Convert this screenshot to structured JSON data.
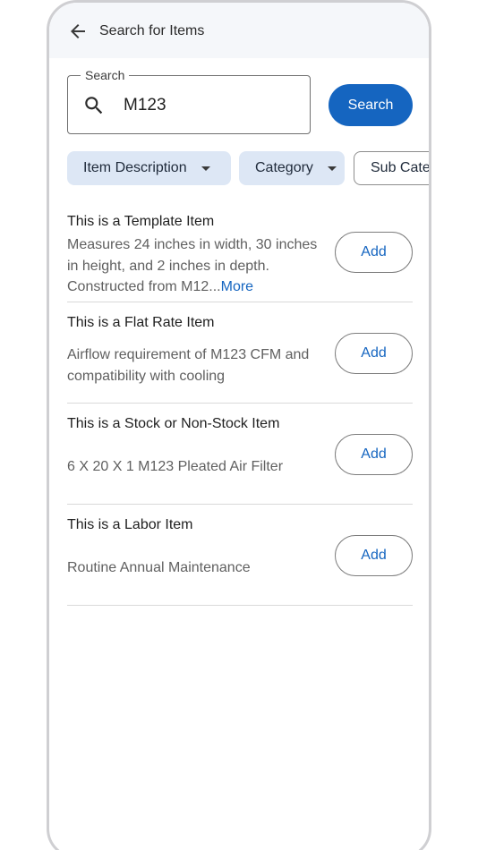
{
  "header": {
    "title": "Search for Items",
    "back_icon": "arrow-left-icon"
  },
  "search": {
    "legend": "Search",
    "value": "M123",
    "icon": "search-icon",
    "button_label": "Search"
  },
  "filters": [
    {
      "label": "Item Description",
      "style": "filled"
    },
    {
      "label": "Category",
      "style": "filled"
    },
    {
      "label": "Sub Cate",
      "style": "outlined"
    }
  ],
  "items": [
    {
      "title": "This is a Template Item",
      "description": "Measures 24 inches in width, 30 inches in height, and 2 inches in depth. Constructed from M12...",
      "more_label": "More",
      "add_label": "Add"
    },
    {
      "title": "This is a Flat Rate Item",
      "description": "Airflow requirement of M123 CFM and compatibility with cooling",
      "add_label": "Add"
    },
    {
      "title": "This is a Stock or Non-Stock Item",
      "description": "6 X 20 X 1 M123 Pleated Air Filter",
      "add_label": "Add"
    },
    {
      "title": "This is a Labor Item",
      "description": "Routine Annual Maintenance",
      "add_label": "Add"
    }
  ],
  "colors": {
    "primary": "#1565c0",
    "chip_fill": "#dde7f5",
    "header_bg": "#f5f7fa"
  }
}
